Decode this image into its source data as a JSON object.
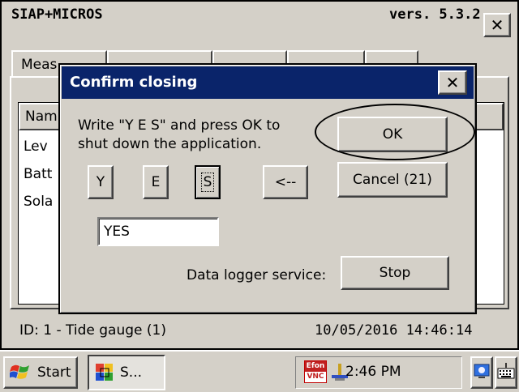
{
  "app": {
    "title": "SIAP+MICROS",
    "version": "vers. 5.3.2",
    "close_glyph": "✕"
  },
  "tabs": [
    {
      "label": "Meas"
    }
  ],
  "list": {
    "header_first": "Nam",
    "rows": [
      "Lev",
      "Batt",
      "Sola"
    ]
  },
  "status": {
    "id_text": "ID: 1 - Tide gauge (1)",
    "datetime": "10/05/2016  14:46:14"
  },
  "dialog": {
    "title": "Confirm closing",
    "close_glyph": "✕",
    "instruction_line1": "Write \"Y E S\" and press OK to",
    "instruction_line2": "shut down the application.",
    "ok_label": "OK",
    "cancel_label": "Cancel (21)",
    "keys": {
      "y": "Y",
      "e": "E",
      "s": "S",
      "back": "<--"
    },
    "input_value": "YES",
    "logger_label": "Data logger service:",
    "stop_label": "Stop"
  },
  "taskbar": {
    "start_label": "Start",
    "app_label": "S...",
    "vnc_badge_top": "Efon",
    "vnc_badge_bottom": "VNC",
    "clock": "2:46 PM"
  },
  "colors": {
    "titlebar": "#0a246a",
    "face": "#d4d0c8"
  }
}
